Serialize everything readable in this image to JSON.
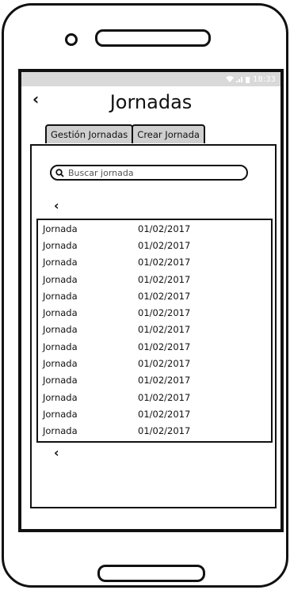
{
  "status_bar": {
    "time": "18:33"
  },
  "header": {
    "title": "Jornadas",
    "back_label": "‹"
  },
  "tabs": [
    {
      "label": "Gestión Jornadas"
    },
    {
      "label": "Crear Jornada"
    }
  ],
  "search": {
    "placeholder": "Buscar jornada",
    "value": ""
  },
  "pager": {
    "prev_label": "‹",
    "next_label": "‹"
  },
  "rows": [
    {
      "name": "Jornada",
      "date": "01/02/2017"
    },
    {
      "name": "Jornada",
      "date": "01/02/2017"
    },
    {
      "name": "Jornada",
      "date": "01/02/2017"
    },
    {
      "name": "Jornada",
      "date": "01/02/2017"
    },
    {
      "name": "Jornada",
      "date": "01/02/2017"
    },
    {
      "name": "Jornada",
      "date": "01/02/2017"
    },
    {
      "name": "Jornada",
      "date": "01/02/2017"
    },
    {
      "name": "Jornada",
      "date": "01/02/2017"
    },
    {
      "name": "Jornada",
      "date": "01/02/2017"
    },
    {
      "name": "Jornada",
      "date": "01/02/2017"
    },
    {
      "name": "Jornada",
      "date": "01/02/2017"
    },
    {
      "name": "Jornada",
      "date": "01/02/2017"
    },
    {
      "name": "Jornada",
      "date": "01/02/2017"
    }
  ]
}
